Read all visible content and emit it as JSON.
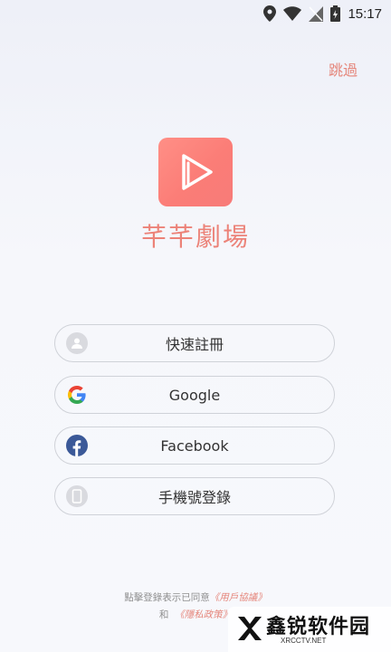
{
  "status_bar": {
    "time": "15:17",
    "icons": [
      "location-icon",
      "wifi-icon",
      "no-sim-icon",
      "battery-icon"
    ]
  },
  "skip_label": "跳過",
  "app": {
    "name": "芊芊劇場",
    "logo_icon": "play-icon"
  },
  "login_options": [
    {
      "label": "快速註冊",
      "icon": "user-icon"
    },
    {
      "label": "Google",
      "icon": "google-icon"
    },
    {
      "label": "Facebook",
      "icon": "facebook-icon"
    },
    {
      "label": "手機號登錄",
      "icon": "phone-icon"
    }
  ],
  "footer": {
    "line1_prefix": "點擊登錄表示已同意",
    "user_agreement": "《用戶協議》",
    "line2_prefix": "和",
    "privacy_policy": "《隱私政策》"
  },
  "watermark": {
    "title": "鑫锐软件园",
    "subtitle": "XRCCTV.NET"
  },
  "colors": {
    "accent": "#e5867b",
    "logo_gradient": [
      "#ff8f86",
      "#f77b78"
    ],
    "border": "#cfd2d8"
  }
}
